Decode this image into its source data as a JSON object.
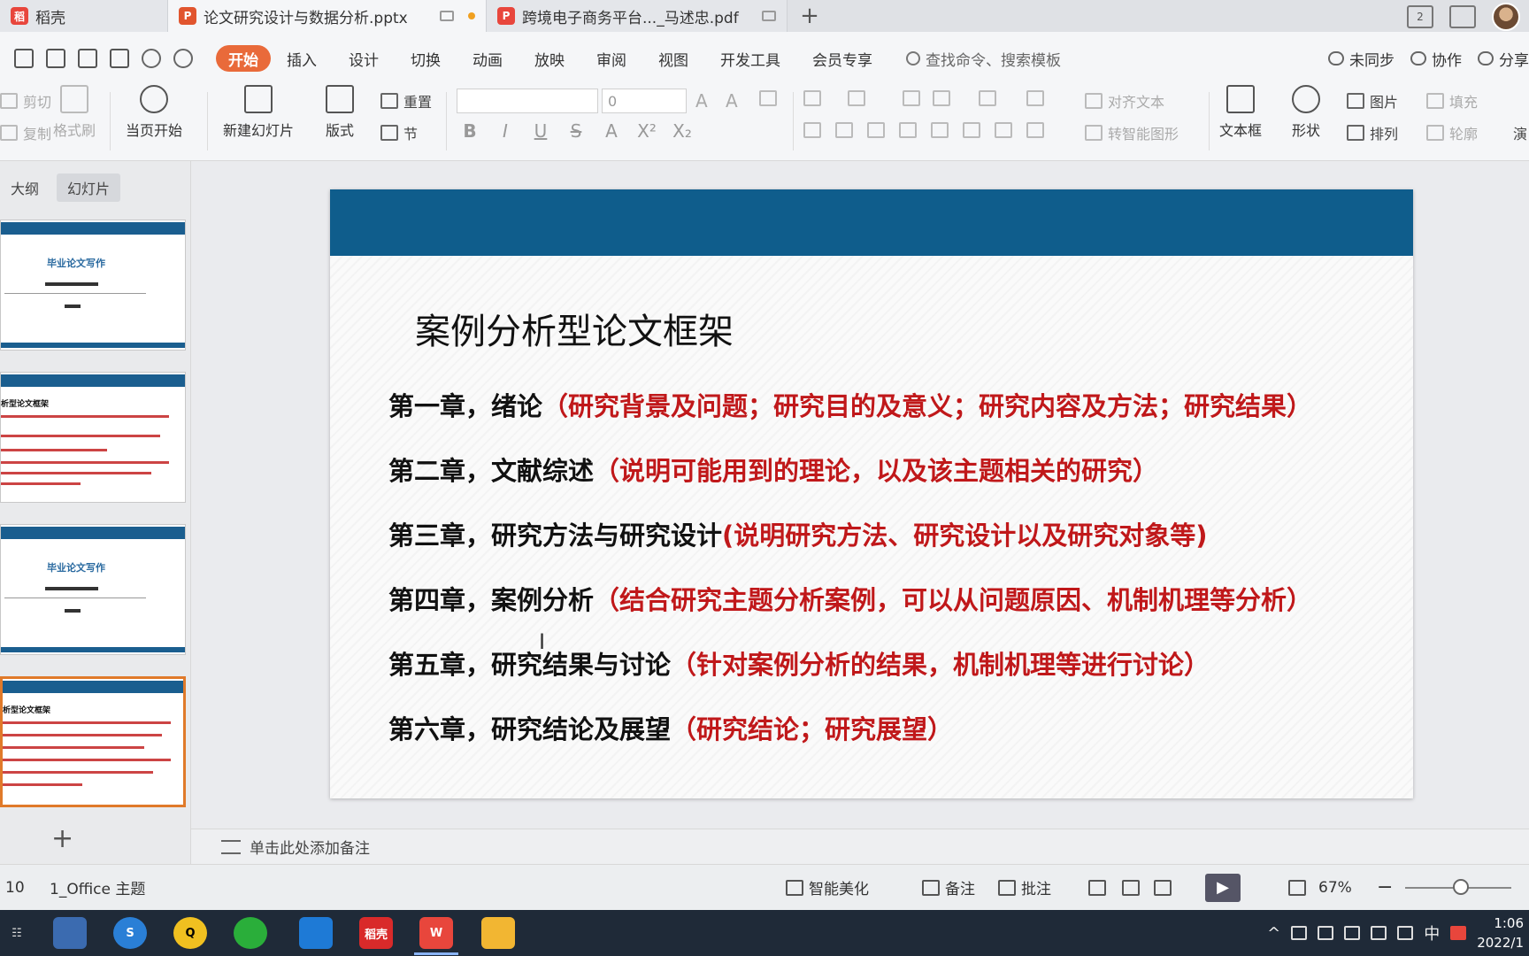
{
  "tabs": {
    "home": "稻壳",
    "active": "论文研究设计与数据分析.pptx",
    "pdf": "跨境电子商务平台..._马述忠.pdf",
    "add": "+"
  },
  "titlebar": {
    "window_count": "2"
  },
  "menu": {
    "items": [
      "开始",
      "插入",
      "设计",
      "切换",
      "动画",
      "放映",
      "审阅",
      "视图",
      "开发工具",
      "会员专享"
    ],
    "search_placeholder": "查找命令、搜索模板",
    "right": [
      "未同步",
      "协作",
      "分享"
    ]
  },
  "ribbon": {
    "cut": "剪切",
    "copy": "复制",
    "format_painter": "格式刷",
    "from_current": "当页开始",
    "new_slide": "新建幻灯片",
    "layout": "版式",
    "reset": "重置",
    "section": "节",
    "font_size": "0",
    "align_text": "对齐文本",
    "smart_art": "转智能图形",
    "textbox": "文本框",
    "shape": "形状",
    "picture": "图片",
    "fill": "填充",
    "arrange": "排列",
    "outline": "轮廓",
    "more": "演"
  },
  "left_panel": {
    "tabs": [
      "大纲",
      "幻灯片"
    ],
    "thumb_title": "毕业论文写作",
    "thumb_outline_title": "析型论文框架",
    "add": "+"
  },
  "slide": {
    "title": "案例分析型论文框架",
    "chapters": [
      {
        "key": "第一章，绪论",
        "desc": "（研究背景及问题；研究目的及意义；研究内容及方法；研究结果）"
      },
      {
        "key": "第二章，文献综述",
        "desc": "（说明可能用到的理论，以及该主题相关的研究）"
      },
      {
        "key": "第三章，研究方法与研究设计",
        "desc": "(说明研究方法、研究设计以及研究对象等)"
      },
      {
        "key": "第四章，案例分析",
        "desc": "（结合研究主题分析案例，可以从问题原因、机制机理等分析）"
      },
      {
        "key": "第五章，研究结果与讨论",
        "desc": "（针对案例分析的结果，机制机理等进行讨论）"
      },
      {
        "key": "第六章，研究结论及展望",
        "desc": "（研究结论；研究展望）"
      }
    ]
  },
  "notes": {
    "placeholder": "单击此处添加备注"
  },
  "status": {
    "slide_num": "10",
    "theme": "1_Office 主题",
    "beautify": "智能美化",
    "notes": "备注",
    "comment": "批注",
    "zoom": "67%"
  },
  "taskbar": {
    "daoke": "稻壳",
    "tray_lang": "中",
    "time": "1:06",
    "date": "2022/1"
  },
  "colors": {
    "accent": "#e96a3a",
    "slide_band": "#0f5d8c",
    "chapter_desc": "#c0181a"
  }
}
